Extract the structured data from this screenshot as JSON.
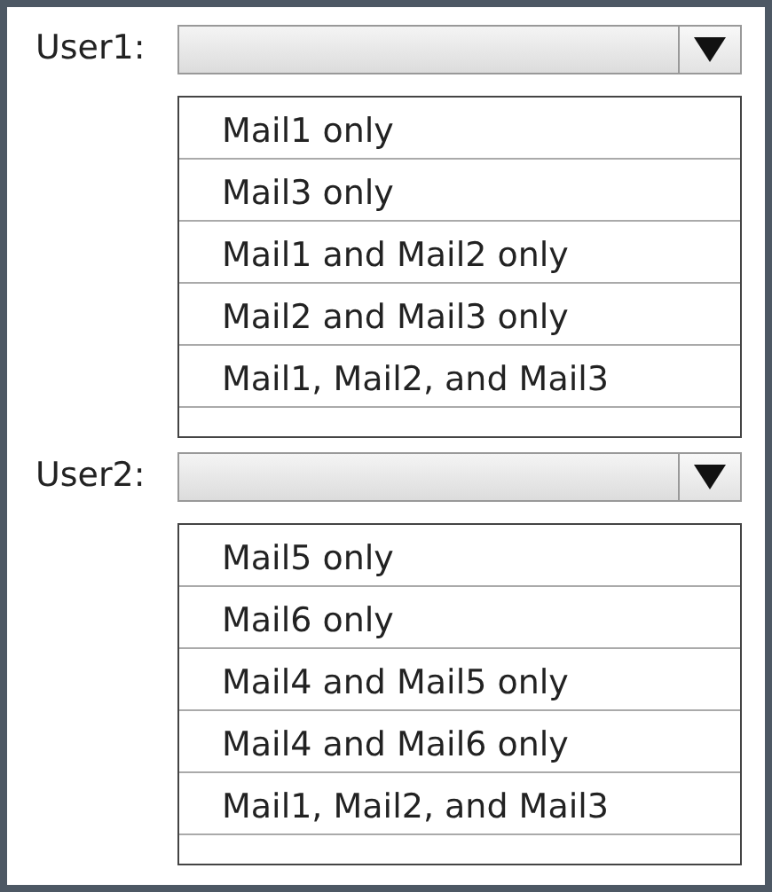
{
  "questions": [
    {
      "label": "User1:",
      "options": [
        "Mail1 only",
        "Mail3 only",
        "Mail1 and Mail2 only",
        "Mail2 and Mail3 only",
        "Mail1, Mail2, and Mail3"
      ]
    },
    {
      "label": "User2:",
      "options": [
        "Mail5 only",
        "Mail6 only",
        "Mail4 and Mail5 only",
        "Mail4 and Mail6 only",
        "Mail1, Mail2, and Mail3"
      ]
    }
  ]
}
